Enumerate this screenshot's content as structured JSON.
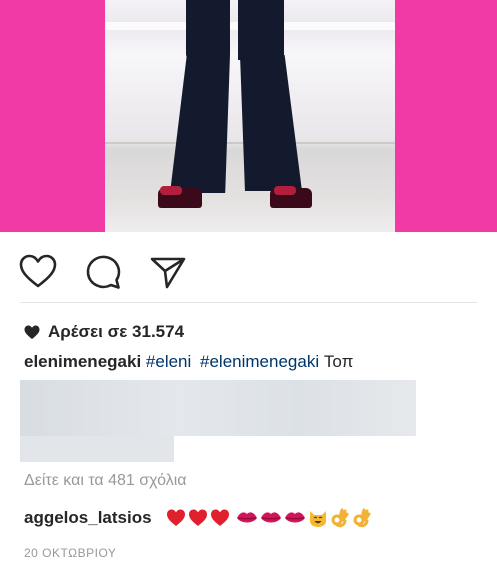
{
  "post": {
    "likes_label": "Αρέσει σε 31.574",
    "caption": {
      "username": "elenimenegaki",
      "hashtags": [
        "#eleni",
        "#elenimenegaki"
      ],
      "trailing_text": "Τοπ"
    },
    "view_comments_label": "Δείτε και τα 481 σχόλια",
    "comment": {
      "username": "aggelos_latsios",
      "emojis": [
        "red-heart",
        "red-heart",
        "red-heart",
        "kiss-mark",
        "kiss-mark",
        "kiss-mark",
        "smiling-cat-face",
        "ok-hand",
        "ok-hand"
      ]
    },
    "timestamp": "20 ΟΚΤΩΒΡΙΟΥ"
  },
  "colors": {
    "pink_background": "#f23aa6",
    "hashtag_link": "#003569",
    "muted_text": "#999999"
  },
  "icons": {
    "like": "heart-outline-icon",
    "comment": "speech-bubble-icon",
    "share": "paper-plane-icon",
    "likes_prefix": "filled-heart-icon"
  }
}
